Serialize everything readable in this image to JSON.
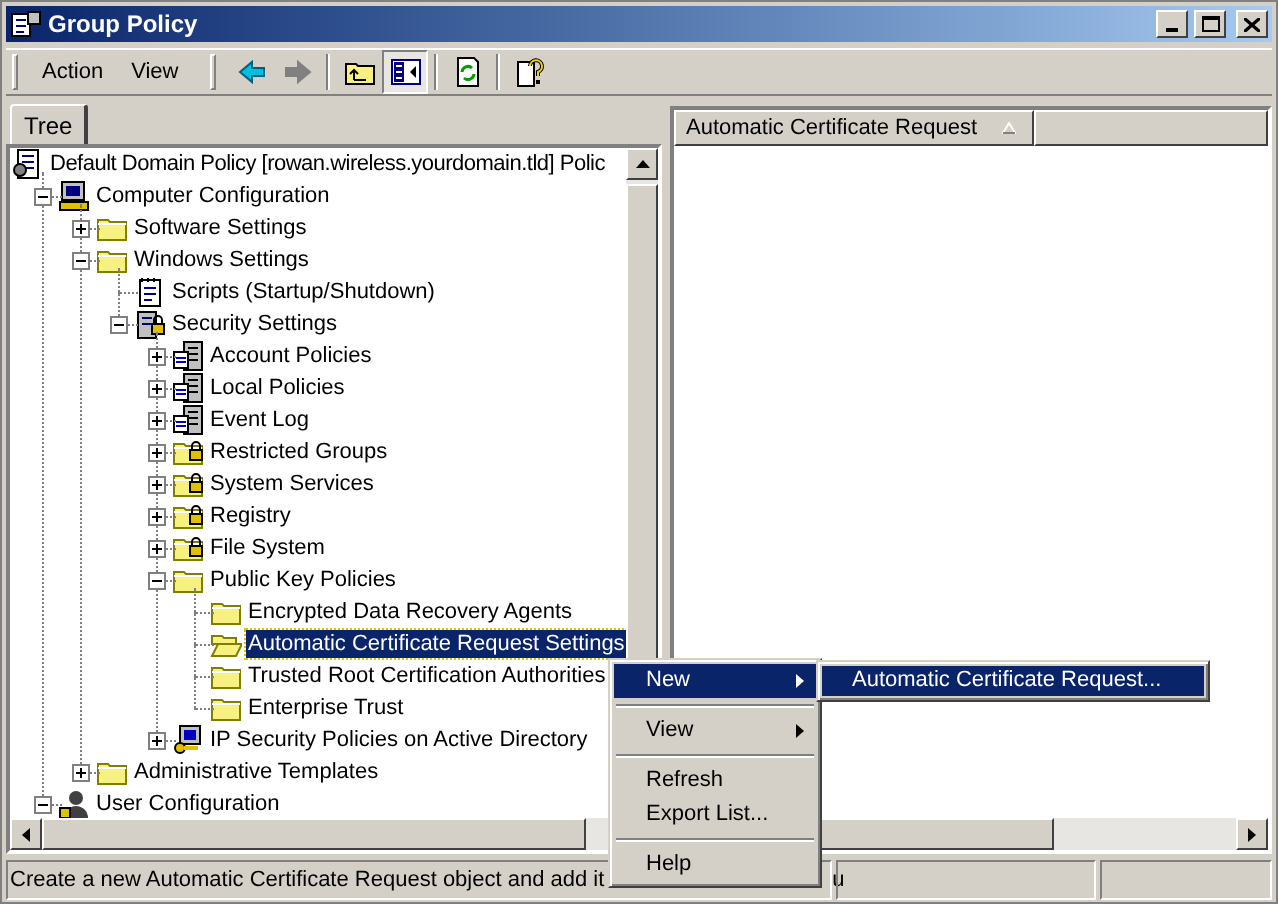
{
  "window": {
    "title": "Group Policy"
  },
  "menu": [
    {
      "label": "Action"
    },
    {
      "label": "View"
    }
  ],
  "toolbar": [
    {
      "kind": "back",
      "disabled": false
    },
    {
      "kind": "forward",
      "disabled": true
    },
    {
      "kind": "up"
    },
    {
      "kind": "tree-toggle",
      "pressed": true
    },
    {
      "kind": "export"
    },
    {
      "kind": "help"
    }
  ],
  "tabs": [
    {
      "label": "Tree",
      "selected": true
    }
  ],
  "tree": {
    "nodes": [
      {
        "label": "Default Domain Policy [rowan.wireless.yourdomain.tld] Polic",
        "kind": "policy",
        "selected": false,
        "children": [
          {
            "label": "Computer Configuration",
            "kind": "computer",
            "expanded": true,
            "selected": false,
            "children": [
              {
                "label": "Software Settings",
                "kind": "folder",
                "expanded": false,
                "selected": false
              },
              {
                "label": "Windows Settings",
                "kind": "folder",
                "expanded": true,
                "selected": false,
                "children": [
                  {
                    "label": "Scripts (Startup/Shutdown)",
                    "kind": "script",
                    "selected": false
                  },
                  {
                    "label": "Security Settings",
                    "kind": "security",
                    "expanded": true,
                    "selected": false,
                    "children": [
                      {
                        "label": "Account Policies",
                        "kind": "server",
                        "expanded": false,
                        "selected": false
                      },
                      {
                        "label": "Local Policies",
                        "kind": "server",
                        "expanded": false,
                        "selected": false
                      },
                      {
                        "label": "Event Log",
                        "kind": "server",
                        "expanded": false,
                        "selected": false
                      },
                      {
                        "label": "Restricted Groups",
                        "kind": "lockfolder",
                        "expanded": false,
                        "selected": false
                      },
                      {
                        "label": "System Services",
                        "kind": "lockfolder",
                        "expanded": false,
                        "selected": false
                      },
                      {
                        "label": "Registry",
                        "kind": "lockfolder",
                        "expanded": false,
                        "selected": false
                      },
                      {
                        "label": "File System",
                        "kind": "lockfolder",
                        "expanded": false,
                        "selected": false
                      },
                      {
                        "label": "Public Key Policies",
                        "kind": "folder",
                        "expanded": true,
                        "selected": false,
                        "children": [
                          {
                            "label": "Encrypted Data Recovery Agents",
                            "kind": "folder",
                            "selected": false
                          },
                          {
                            "label": "Automatic Certificate Request Settings",
                            "kind": "folder-open",
                            "selected": true
                          },
                          {
                            "label": "Trusted Root Certification Authorities",
                            "kind": "folder",
                            "selected": false
                          },
                          {
                            "label": "Enterprise Trust",
                            "kind": "folder",
                            "selected": false
                          }
                        ]
                      },
                      {
                        "label": "IP Security Policies on Active Directory",
                        "kind": "ipsec",
                        "expanded": false,
                        "selected": false
                      }
                    ]
                  }
                ]
              },
              {
                "label": "Administrative Templates",
                "kind": "folder",
                "expanded": false,
                "selected": false
              }
            ]
          },
          {
            "label": "User Configuration",
            "kind": "user",
            "expanded": true,
            "selected": false
          }
        ]
      }
    ]
  },
  "list": {
    "columns": [
      {
        "label": "Automatic Certificate Request",
        "sorted": true
      }
    ]
  },
  "context_menu": {
    "items": [
      {
        "kind": "item",
        "label": "New",
        "submenu": true,
        "selected": true
      },
      {
        "kind": "separator"
      },
      {
        "kind": "item",
        "label": "View",
        "submenu": true,
        "selected": false
      },
      {
        "kind": "separator"
      },
      {
        "kind": "item",
        "label": "Refresh",
        "submenu": false,
        "selected": false
      },
      {
        "kind": "item",
        "label": "Export List...",
        "submenu": false,
        "selected": false
      },
      {
        "kind": "separator"
      },
      {
        "kind": "item",
        "label": "Help",
        "submenu": false,
        "selected": false
      }
    ]
  },
  "submenu": {
    "items": [
      {
        "label": "Automatic Certificate Request...",
        "selected": true
      }
    ]
  },
  "status_bar": {
    "text": "Create a new Automatic Certificate Request object and add it",
    "text_continued": "u"
  }
}
